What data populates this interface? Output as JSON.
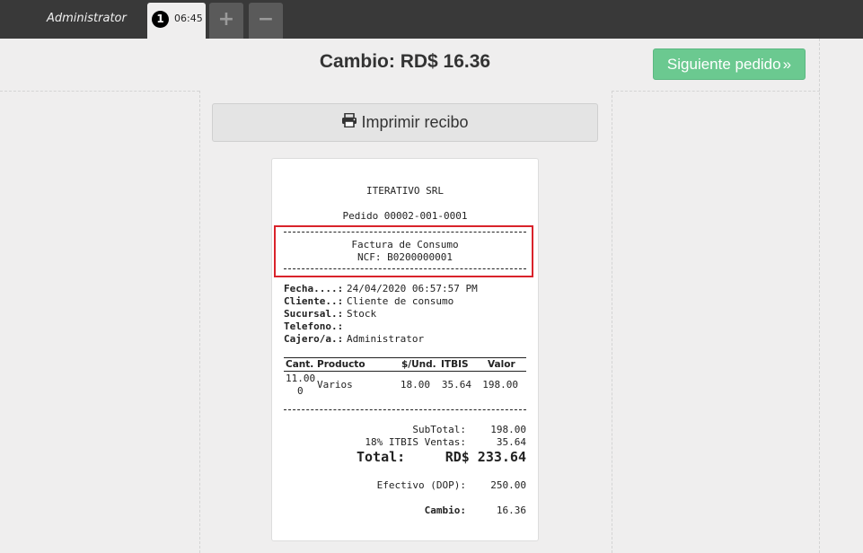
{
  "topbar": {
    "user": "Administrator",
    "tab_number": "1",
    "tab_time": "06:45",
    "add_label": "+",
    "remove_label": "−"
  },
  "header": {
    "cambio_title": "Cambio: RD$ 16.36",
    "next_button": "Siguiente pedido",
    "next_icon": "»"
  },
  "print_button": {
    "label": "Imprimir recibo",
    "icon": "printer-icon"
  },
  "receipt": {
    "company": "ITERATIVO SRL",
    "order": "Pedido 00002-001-0001",
    "invoice_type": "Factura de Consumo",
    "ncf": "NCF: B0200000001",
    "info": [
      {
        "label": "Fecha....:",
        "value": "24/04/2020 06:57:57 PM"
      },
      {
        "label": "Cliente..:",
        "value": "Cliente de consumo"
      },
      {
        "label": "Sucursal.:",
        "value": "Stock"
      },
      {
        "label": "Telefono.:",
        "value": ""
      },
      {
        "label": "Cajero/a.:",
        "value": "Administrator"
      }
    ],
    "columns": {
      "qty": "Cant.",
      "product": "Producto",
      "unit": "$/Und.",
      "itbis": "ITBIS",
      "value": "Valor"
    },
    "items": [
      {
        "qty_line1": "11.00",
        "qty_line2": "0",
        "product": "Varios",
        "unit": "18.00",
        "itbis": "35.64",
        "value": "198.00"
      }
    ],
    "subtotal_label": "SubTotal:",
    "subtotal_value": "198.00",
    "itbis_label": "18% ITBIS Ventas:",
    "itbis_value": "35.64",
    "total_label": "Total:",
    "total_value": "RD$ 233.64",
    "cash_label": "Efectivo (DOP):",
    "cash_value": "250.00",
    "change_label": "Cambio:",
    "change_value": "16.36"
  }
}
